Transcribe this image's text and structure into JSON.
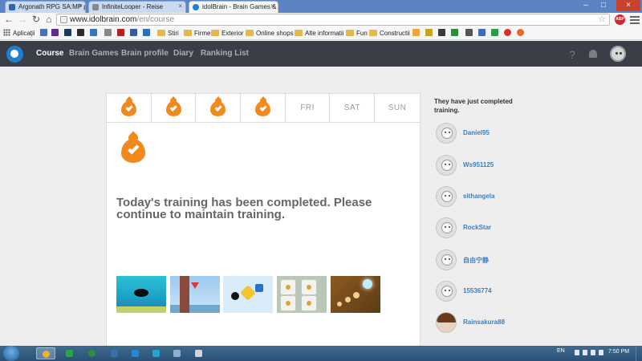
{
  "browser": {
    "tabs": [
      {
        "title": "Argonath RPG SA:MP par",
        "active": false
      },
      {
        "title": "InfiniteLooper - Reise",
        "active": false
      },
      {
        "title": "idolBrain - Brain Games &",
        "active": true
      }
    ],
    "url_host": "www.idolbrain.com",
    "url_path": "/en/course",
    "abp_label": "ABP",
    "bookmarks": [
      {
        "label": "Aplicații",
        "icon": "apps-icon"
      },
      {
        "label": "Stiri",
        "icon": "folder-icon"
      },
      {
        "label": "Firme",
        "icon": "folder-icon"
      },
      {
        "label": "Exterior",
        "icon": "folder-icon"
      },
      {
        "label": "Online shops",
        "icon": "folder-icon"
      },
      {
        "label": "Alte informatii",
        "icon": "folder-icon"
      },
      {
        "label": "Fun",
        "icon": "folder-icon"
      },
      {
        "label": "Constructii",
        "icon": "folder-icon"
      }
    ]
  },
  "nav": {
    "links": [
      "Course",
      "Brain Games",
      "Brain profile",
      "Diary",
      "Ranking List"
    ],
    "active": "Course",
    "help_label": "?"
  },
  "week": {
    "days": [
      {
        "label": "",
        "completed": true
      },
      {
        "label": "",
        "completed": true
      },
      {
        "label": "",
        "completed": true
      },
      {
        "label": "",
        "completed": true
      },
      {
        "label": "FRI",
        "completed": false
      },
      {
        "label": "SAT",
        "completed": false
      },
      {
        "label": "SUN",
        "completed": false
      }
    ]
  },
  "status": {
    "message": "Today's training has been completed. Please continue to maintain training."
  },
  "games": [
    "fish-game",
    "flag-game",
    "shapes-game",
    "dice-game",
    "light-game"
  ],
  "sidebar": {
    "title": "They have just completed training.",
    "users": [
      "Daniel95",
      "Ws951125",
      "sithangela",
      "RockStar",
      "自由宁静",
      "15536774",
      "Rainsakura88"
    ]
  },
  "taskbar": {
    "language": "EN",
    "time": "7:50 PM"
  },
  "colors": {
    "flame": "#f0891e",
    "nav_bg": "#3a3f47",
    "username": "#3b7fc4"
  }
}
